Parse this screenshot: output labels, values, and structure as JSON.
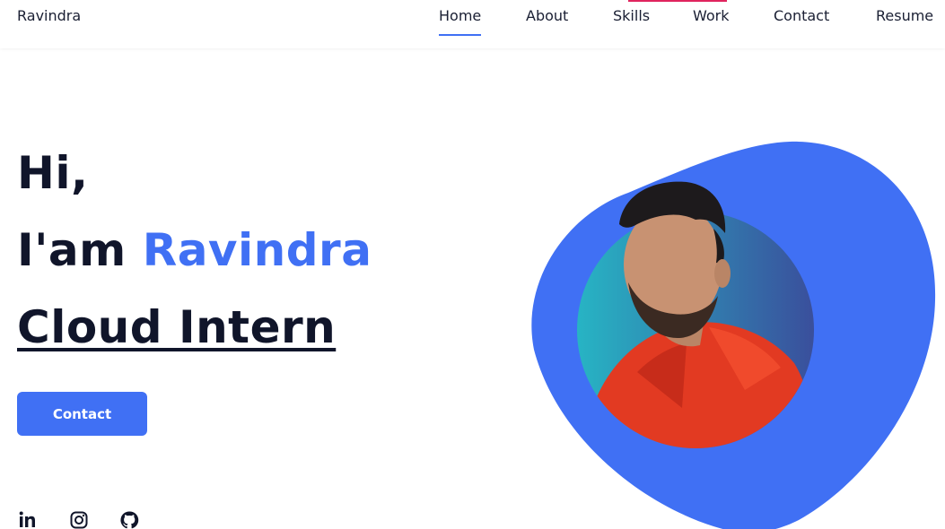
{
  "header": {
    "logo": "Ravindra",
    "nav": [
      {
        "label": "Home"
      },
      {
        "label": "About"
      },
      {
        "label": "Skills"
      },
      {
        "label": "Work"
      },
      {
        "label": "Contact"
      },
      {
        "label": "Resume"
      }
    ]
  },
  "hero": {
    "greeting": "Hi,",
    "intro_prefix": "I'am",
    "name": "Ravindra",
    "role": "Cloud Intern",
    "contact_button": "Contact"
  },
  "socials": [
    {
      "icon": "linkedin-icon"
    },
    {
      "icon": "instagram-icon"
    },
    {
      "icon": "github-icon"
    }
  ],
  "colors": {
    "accent": "#4070f4",
    "text": "#10152a",
    "pink_indicator": "#e0245e"
  }
}
